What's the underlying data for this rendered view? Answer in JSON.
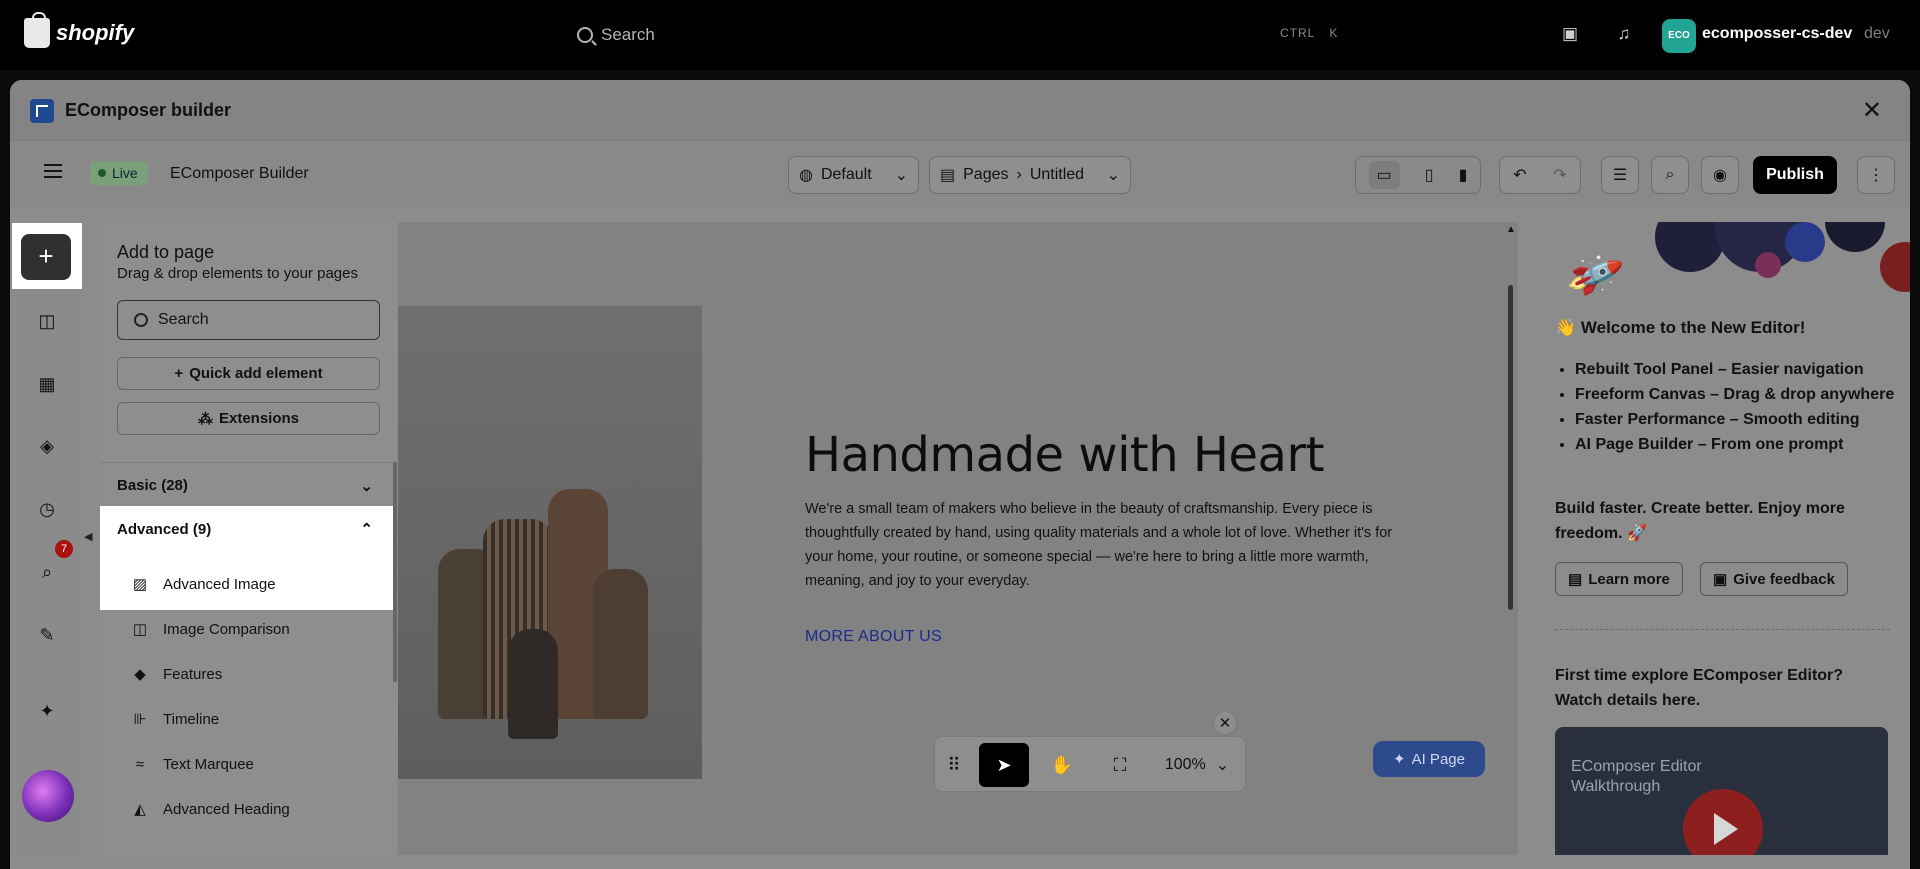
{
  "topbar": {
    "brand": "shopify",
    "search_label": "Search",
    "shortcut_ctrl": "CTRL",
    "shortcut_key": "K",
    "avatar_initials": "ECO",
    "store_name": "ecomposser-cs-dev",
    "store_suffix": "dev"
  },
  "modal": {
    "title": "EComposer builder",
    "close": "✕"
  },
  "toolbar": {
    "status": "Live",
    "title": "EComposer Builder",
    "theme_select": "Default",
    "pages_label": "Pages",
    "page_name": "Untitled",
    "publish": "Publish"
  },
  "rail": {
    "add_icon": "+",
    "badge_count": "7"
  },
  "panel": {
    "title": "Add to page",
    "subtitle": "Drag & drop elements to your pages",
    "search_placeholder": "Search",
    "quick_add": "Quick add element",
    "extensions": "Extensions",
    "sections": [
      {
        "label": "Basic (28)"
      },
      {
        "label": "Advanced (9)"
      }
    ],
    "elements": [
      {
        "label": "Advanced Image",
        "icon": "image-icon"
      },
      {
        "label": "Image Comparison",
        "icon": "compare-icon"
      },
      {
        "label": "Features",
        "icon": "diamond-icon"
      },
      {
        "label": "Timeline",
        "icon": "timeline-icon"
      },
      {
        "label": "Text Marquee",
        "icon": "marquee-icon"
      },
      {
        "label": "Advanced Heading",
        "icon": "heading-icon"
      }
    ]
  },
  "canvas": {
    "heading": "Handmade with Heart",
    "paragraph": "We're a small team of makers who believe in the beauty of craftsmanship. Every piece is thoughtfully created by hand, using quality materials and a whole lot of love. Whether it's for your home, your routine, or someone special — we're here to bring a little more warmth, meaning, and joy to your everyday.",
    "link": "MORE ABOUT US",
    "ai_button": "AI Page",
    "zoom": "100%"
  },
  "right_panel": {
    "welcome": "👋 Welcome to the New Editor!",
    "features": [
      "Rebuilt Tool Panel – Easier navigation",
      "Freeform Canvas – Drag & drop anywhere",
      "Faster Performance – Smooth editing",
      "AI Page Builder – From one prompt"
    ],
    "tagline": "Build faster. Create better. Enjoy more freedom. 🚀",
    "learn_more": "Learn more",
    "give_feedback": "Give feedback",
    "explore": "First time explore EComposer Editor? Watch details here.",
    "video_title": "EComposer Editor Walkthrough"
  }
}
